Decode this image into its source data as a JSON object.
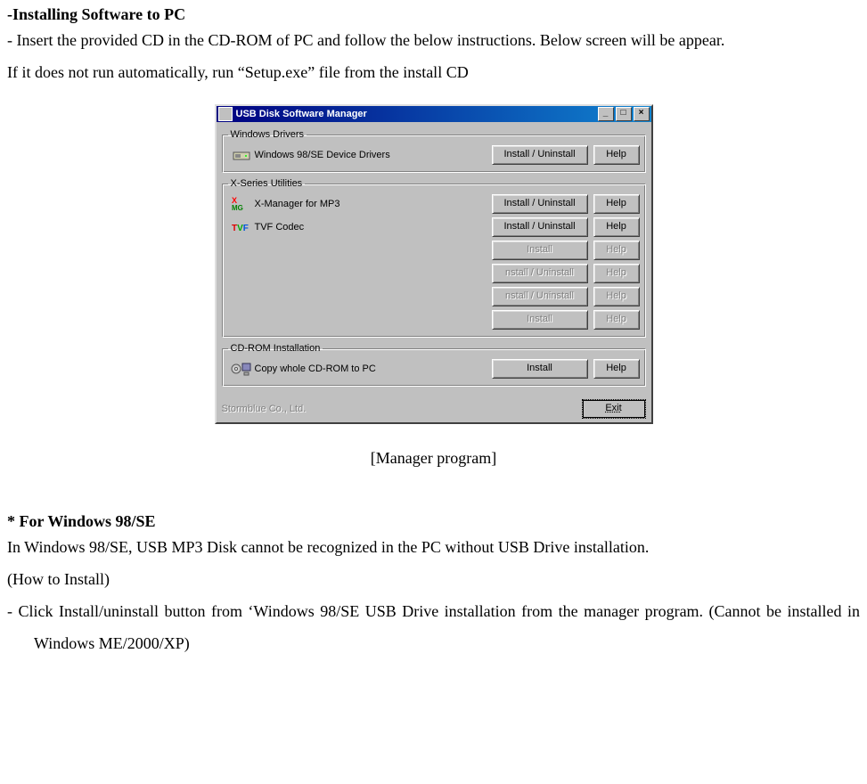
{
  "doc": {
    "heading": "-Installing Software to PC",
    "p1": "- Insert the provided CD in the CD-ROM of PC and follow the below instructions. Below screen will be appear.",
    "p2": "If it does not run automatically, run “Setup.exe” file from the install CD",
    "caption": "[Manager program]",
    "sec2": "* For Windows 98/SE",
    "p3": "In Windows 98/SE, USB MP3 Disk cannot be recognized in the PC without USB Drive installation.",
    "p4": "(How to Install)",
    "p5": "-   Click Install/uninstall button from ‘Windows 98/SE USB Drive installation from the manager program. (Cannot be installed in Windows ME/2000/XP)"
  },
  "dialog": {
    "title": "USB Disk Software Manager",
    "min": "_",
    "max": "□",
    "close": "×",
    "group1": {
      "legend": "Windows Drivers",
      "row": "Windows 98/SE Device Drivers"
    },
    "group2": {
      "legend": "X-Series Utilities",
      "row1": "X-Manager for MP3",
      "row2": "TVF Codec"
    },
    "group3": {
      "legend": "CD-ROM Installation",
      "row": "Copy whole CD-ROM to PC"
    },
    "btns": {
      "install_uninstall": "Install / Uninstall",
      "install_uninstall_d": "nstall / Uninstall",
      "install": "Install",
      "help": "Help",
      "exit": "Exit"
    },
    "company": "Stormblue Co., Ltd."
  }
}
